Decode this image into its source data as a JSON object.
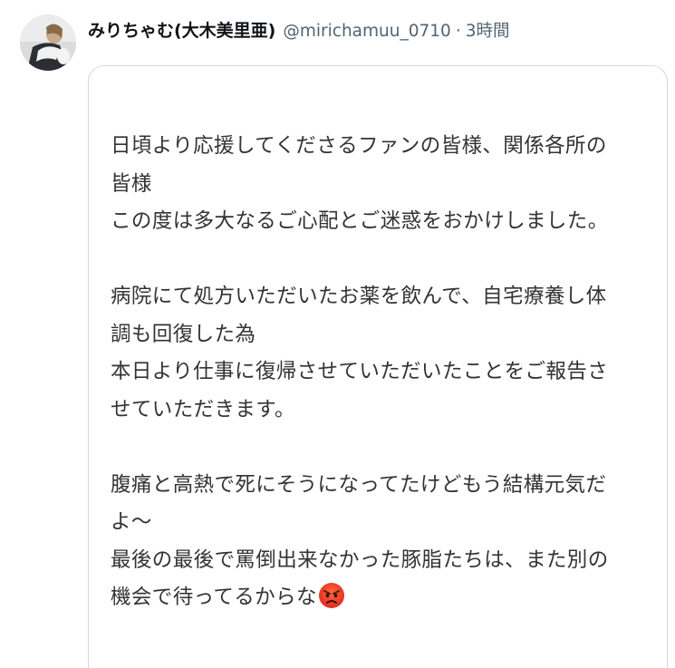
{
  "tweet": {
    "display_name": "みりちゃむ(大木美里亜)",
    "handle": "@mirichamuu_0710",
    "separator": "·",
    "time": "3時間",
    "avatar_icon": "profile-photo-avatar"
  },
  "image_text": {
    "lines": [
      "日頃より応援してくださるファンの皆様、関係各所の",
      "皆様",
      "この度は多大なるご心配とご迷惑をおかけしました。",
      "",
      "病院にて処方いただいたお薬を飲んで、自宅療養し体",
      "調も回復した為",
      "本日より仕事に復帰させていただいたことをご報告さ",
      "せていただきます。",
      "",
      "腹痛と高熱で死にそうになってたけどもう結構元気だ",
      "よ〜",
      "最後の最後で罵倒出来なかった豚脂たちは、また別の",
      "機会で待ってるからな"
    ],
    "emoji_icon": "angry-face-emoji"
  }
}
